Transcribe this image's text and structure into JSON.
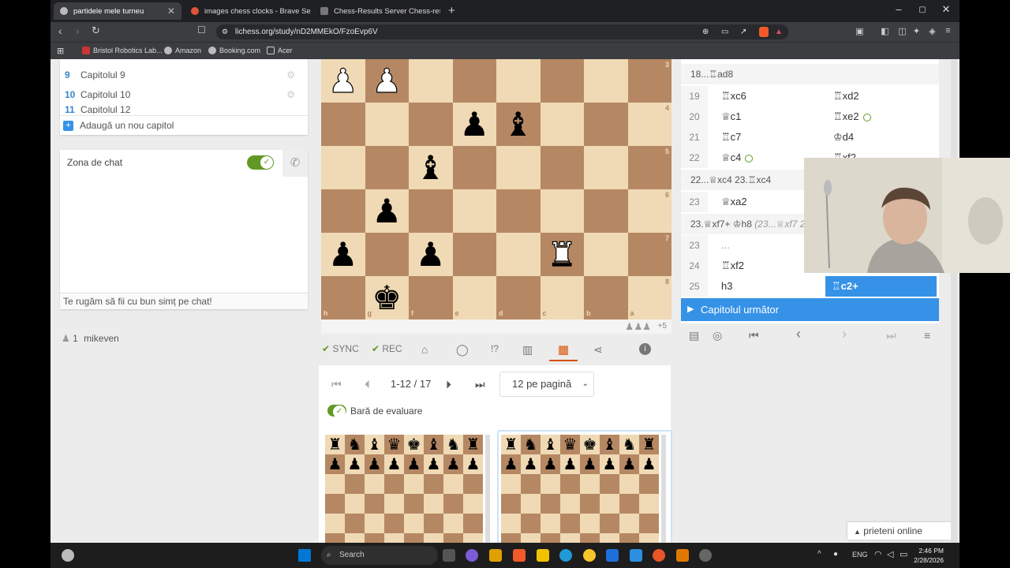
{
  "browser": {
    "tabs": [
      {
        "label": "partidele mele turneu",
        "active": true
      },
      {
        "label": "images chess clocks - Brave Search",
        "active": false
      },
      {
        "label": "Chess-Results Server Chess-results.co",
        "active": false
      }
    ],
    "new_tab": "+",
    "url": "lichess.org/study/nD2MMEkO/FzoEvp6V",
    "bookmarks": [
      "Bristol Robotics Lab...",
      "Amazon",
      "Booking.com",
      "Acer"
    ]
  },
  "chapters": [
    {
      "n": "9",
      "label": "Capitolul 9"
    },
    {
      "n": "10",
      "label": "Capitolul 10"
    },
    {
      "n": "11",
      "label": "Capitolul 12"
    }
  ],
  "add_chapter": "Adaugă un nou capitol",
  "chat": {
    "title": "Zona de chat",
    "placeholder": "Te rugăm să fii cu bun simț pe chat!"
  },
  "members": {
    "count": "1",
    "name": "mikeven"
  },
  "board": {
    "files": [
      "h",
      "g",
      "f",
      "e",
      "d",
      "c",
      "b",
      "a"
    ],
    "ranks": [
      "3",
      "4",
      "5",
      "6",
      "7",
      "8"
    ],
    "bottom_extra": "+5"
  },
  "toolbar": {
    "sync": "SYNC",
    "rec": "REC"
  },
  "games": {
    "range": "1-12 / 17",
    "per_page": "12 pe pagină",
    "eval_bar": "Bară de evaluare"
  },
  "moves": {
    "top_variation": "18...♖ad8",
    "rows": [
      {
        "n": "19",
        "w": "♖xc6",
        "b": "♖xd2"
      },
      {
        "n": "20",
        "w": "♕c1",
        "b": "♖xe2"
      },
      {
        "n": "21",
        "w": "♖c7",
        "b": "♔d4"
      },
      {
        "n": "22",
        "w": "♕c4",
        "b": "♖xf2"
      }
    ],
    "var2": "22...♕xc4  23.♖xc4",
    "row23": {
      "n": "23",
      "w": "♕xa2"
    },
    "var3_main": "23.♕xf7+  ♔h8",
    "var3_alt": "(23...♕xf7 2",
    "row23b": {
      "n": "23",
      "w": "..."
    },
    "row24": {
      "n": "24",
      "w": "♖xf2"
    },
    "row25": {
      "n": "25",
      "w": "h3",
      "b": "♖c2+"
    },
    "next_chapter": "Capitolul următor"
  },
  "taskbar": {
    "search": "Search",
    "lang": "ENG",
    "time": "2:46 PM",
    "date": "2/28/2026",
    "friends": "prieteni online"
  }
}
